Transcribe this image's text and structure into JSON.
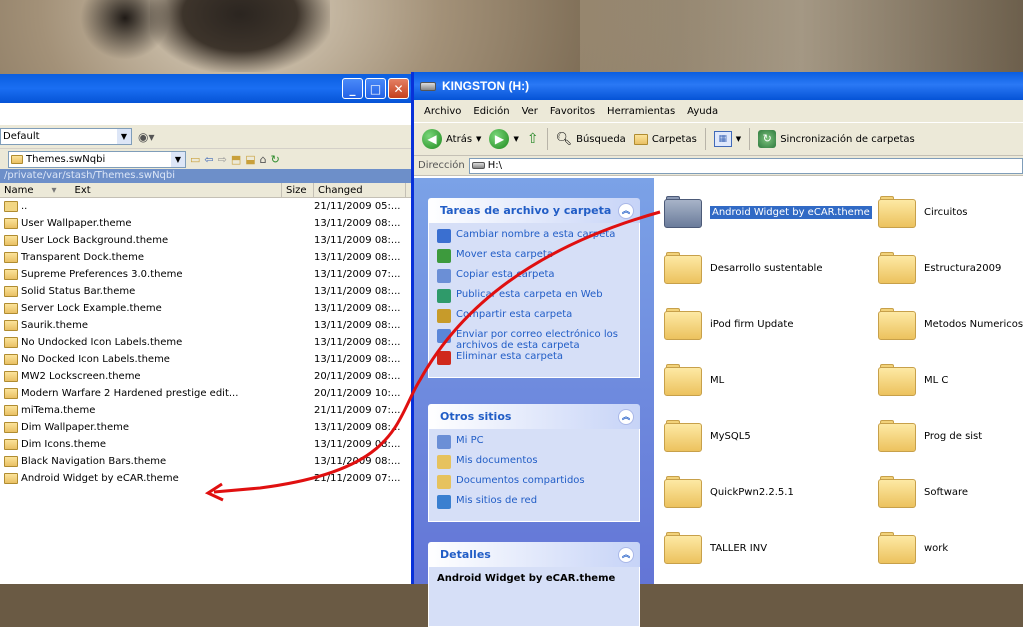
{
  "left_window": {
    "profile": "Default",
    "folder_combo": "Themes.swNqbi",
    "path": "/private/var/stash/Themes.swNqbi",
    "columns": {
      "name": "Name",
      "ext": "Ext",
      "size": "Size",
      "changed": "Changed"
    },
    "files": [
      {
        "name": "..",
        "changed": "21/11/2009 05:..."
      },
      {
        "name": "User Wallpaper.theme",
        "changed": "13/11/2009 08:..."
      },
      {
        "name": "User Lock Background.theme",
        "changed": "13/11/2009 08:..."
      },
      {
        "name": "Transparent Dock.theme",
        "changed": "13/11/2009 08:..."
      },
      {
        "name": "Supreme Preferences 3.0.theme",
        "changed": "13/11/2009 07:..."
      },
      {
        "name": "Solid Status Bar.theme",
        "changed": "13/11/2009 08:..."
      },
      {
        "name": "Server Lock Example.theme",
        "changed": "13/11/2009 08:..."
      },
      {
        "name": "Saurik.theme",
        "changed": "13/11/2009 08:..."
      },
      {
        "name": "No Undocked Icon Labels.theme",
        "changed": "13/11/2009 08:..."
      },
      {
        "name": "No Docked Icon Labels.theme",
        "changed": "13/11/2009 08:..."
      },
      {
        "name": "MW2 Lockscreen.theme",
        "changed": "20/11/2009 08:..."
      },
      {
        "name": "Modern Warfare 2 Hardened prestige edit...",
        "changed": "20/11/2009 10:..."
      },
      {
        "name": "miTema.theme",
        "changed": "21/11/2009 07:..."
      },
      {
        "name": "Dim Wallpaper.theme",
        "changed": "13/11/2009 08:..."
      },
      {
        "name": "Dim Icons.theme",
        "changed": "13/11/2009 08:..."
      },
      {
        "name": "Black Navigation Bars.theme",
        "changed": "13/11/2009 08:..."
      },
      {
        "name": "Android Widget by eCAR.theme",
        "changed": "21/11/2009 07:..."
      }
    ]
  },
  "right_window": {
    "title": "KINGSTON (H:)",
    "menu": [
      "Archivo",
      "Edición",
      "Ver",
      "Favoritos",
      "Herramientas",
      "Ayuda"
    ],
    "toolbar": {
      "back": "Atrás",
      "search": "Búsqueda",
      "folders": "Carpetas",
      "sync": "Sincronización de carpetas"
    },
    "address_label": "Dirección",
    "address_value": "H:\\",
    "tasks": {
      "title": "Tareas de archivo y carpeta",
      "items": [
        "Cambiar nombre a esta carpeta",
        "Mover esta carpeta",
        "Copiar esta carpeta",
        "Publicar esta carpeta en Web",
        "Compartir esta carpeta",
        "Enviar por correo electrónico los archivos de esta carpeta",
        "Eliminar esta carpeta"
      ]
    },
    "other_places": {
      "title": "Otros sitios",
      "items": [
        "Mi PC",
        "Mis documentos",
        "Documentos compartidos",
        "Mis sitios de red"
      ]
    },
    "details": {
      "title": "Detalles",
      "name": "Android Widget by eCAR.theme"
    },
    "folders": [
      "Android Widget by eCAR.theme",
      "Circuitos",
      "Desarrollo sustentable",
      "Estructura2009",
      "iPod firm Update",
      "Metodos Numericos",
      "ML",
      "ML C",
      "MySQL5",
      "Prog de sist",
      "QuickPwn2.2.5.1",
      "Software",
      "TALLER INV",
      "work"
    ]
  },
  "colors": {
    "xp_blue": "#0a5ee0",
    "selection": "#316ac5",
    "arrow": "#e01010"
  }
}
